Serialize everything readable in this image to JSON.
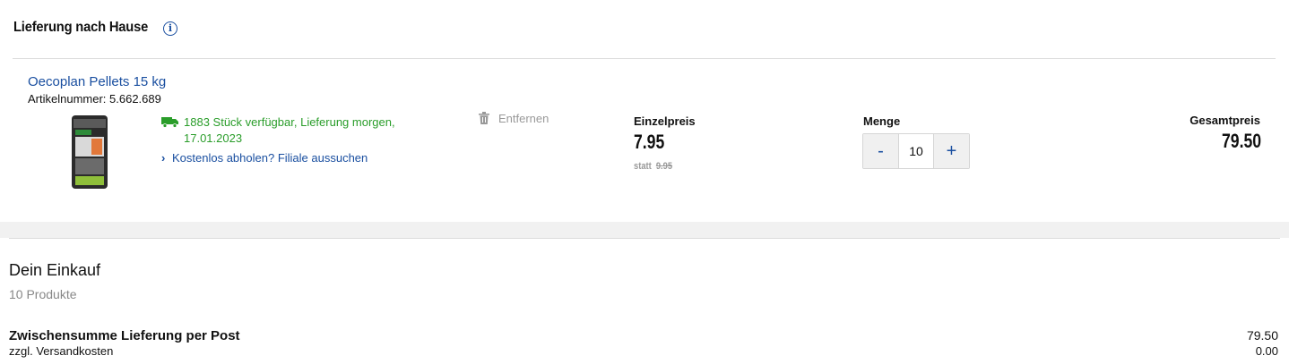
{
  "header": {
    "title": "Lieferung nach Hause",
    "info_icon": "info-icon"
  },
  "product": {
    "name": "Oecoplan Pellets 15 kg",
    "article": "Artikelnummer: 5.662.689",
    "availability": "1883 Stück verfügbar, Lieferung morgen, 17.01.2023",
    "pickup": "Kostenlos abholen? Filiale aussuchen",
    "remove": "Entfernen"
  },
  "pricing": {
    "unit_label": "Einzelpreis",
    "unit_price": "7.95",
    "old_prefix": "statt",
    "old_price": "9.95",
    "qty_label": "Menge",
    "qty_minus": "-",
    "qty_value": "10",
    "qty_plus": "+",
    "total_label": "Gesamtpreis",
    "total_price": "79.50"
  },
  "summary": {
    "title": "Dein Einkauf",
    "count": "10 Produkte",
    "subtotal_label": "Zwischensumme Lieferung per Post",
    "subtotal_value": "79.50",
    "shipping_label": "zzgl. Versandkosten",
    "shipping_value": "0.00"
  },
  "colors": {
    "link": "#1a4fa0",
    "available": "#2a9d2a",
    "muted": "#999999"
  }
}
